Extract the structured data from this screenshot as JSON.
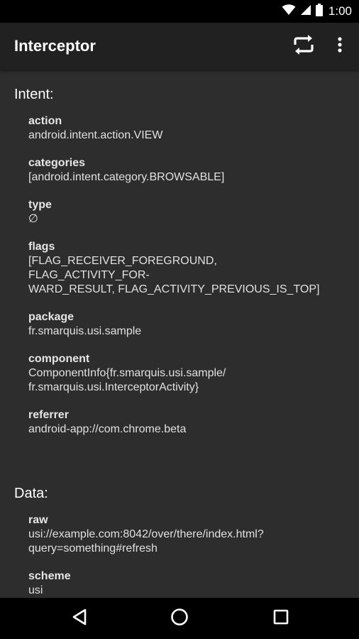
{
  "status_bar": {
    "time": "1:00",
    "icons": [
      "wifi-icon",
      "signal-icon",
      "battery-icon"
    ]
  },
  "app_bar": {
    "title": "Interceptor",
    "actions": [
      "repeat-icon",
      "more-vert-icon"
    ]
  },
  "intent": {
    "title": "Intent:",
    "fields": [
      {
        "label": "action",
        "value": "android.intent.action.VIEW"
      },
      {
        "label": "categories",
        "value": "[android.intent.category.BROWSABLE]"
      },
      {
        "label": "type",
        "value": "∅"
      },
      {
        "label": "flags",
        "value": "[FLAG_RECEIVER_FOREGROUND, FLAG_ACTIVITY_FOR-\nWARD_RESULT, FLAG_ACTIVITY_PREVIOUS_IS_TOP]"
      },
      {
        "label": "package",
        "value": "fr.smarquis.usi.sample"
      },
      {
        "label": "component",
        "value": "ComponentInfo{fr.smarquis.usi.sample/\nfr.smarquis.usi.InterceptorActivity}"
      },
      {
        "label": "referrer",
        "value": "android-app://com.chrome.beta"
      }
    ]
  },
  "data": {
    "title": "Data:",
    "fields": [
      {
        "label": "raw",
        "value": "usi://example.com:8042/over/there/index.html?\nquery=something#refresh"
      },
      {
        "label": "scheme",
        "value": "usi"
      }
    ]
  },
  "nav_bar": {
    "buttons": [
      "back-icon",
      "home-icon",
      "recents-icon"
    ]
  },
  "colors": {
    "background": "#2d2d2d",
    "app_bar": "#212121",
    "status_bar": "#000000",
    "text": "#e6e6e6"
  }
}
